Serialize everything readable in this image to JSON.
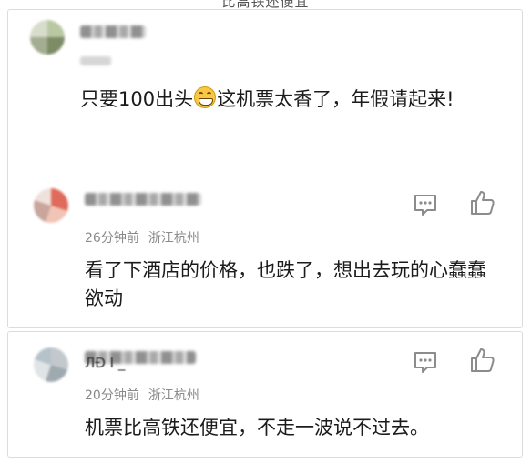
{
  "page": {
    "cut_header": "比高铁还便宜"
  },
  "comments": [
    {
      "user_display": "",
      "text_before_emoji": "只要100出头",
      "emoji": "grinning-face-emoji",
      "text_after_emoji": "这机票太香了，年假请起来!"
    },
    {
      "user_display": "",
      "time": "26分钟前",
      "location": "浙江杭州",
      "text": "看了下酒店的价格，也跌了，想出去玩的心蠢蠢欲动"
    },
    {
      "user_display": "ЛĐ Ⅰ _",
      "time": "20分钟前",
      "location": "浙江杭州",
      "text": "机票比高铁还便宜，不走一波说不过去。"
    }
  ],
  "icons": {
    "comment": "comment-icon",
    "like": "thumbs-up-icon"
  },
  "colors": {
    "meta_gray": "#8a8a8a",
    "icon_gray": "#8c8c8c",
    "border": "#dcdcdc"
  }
}
